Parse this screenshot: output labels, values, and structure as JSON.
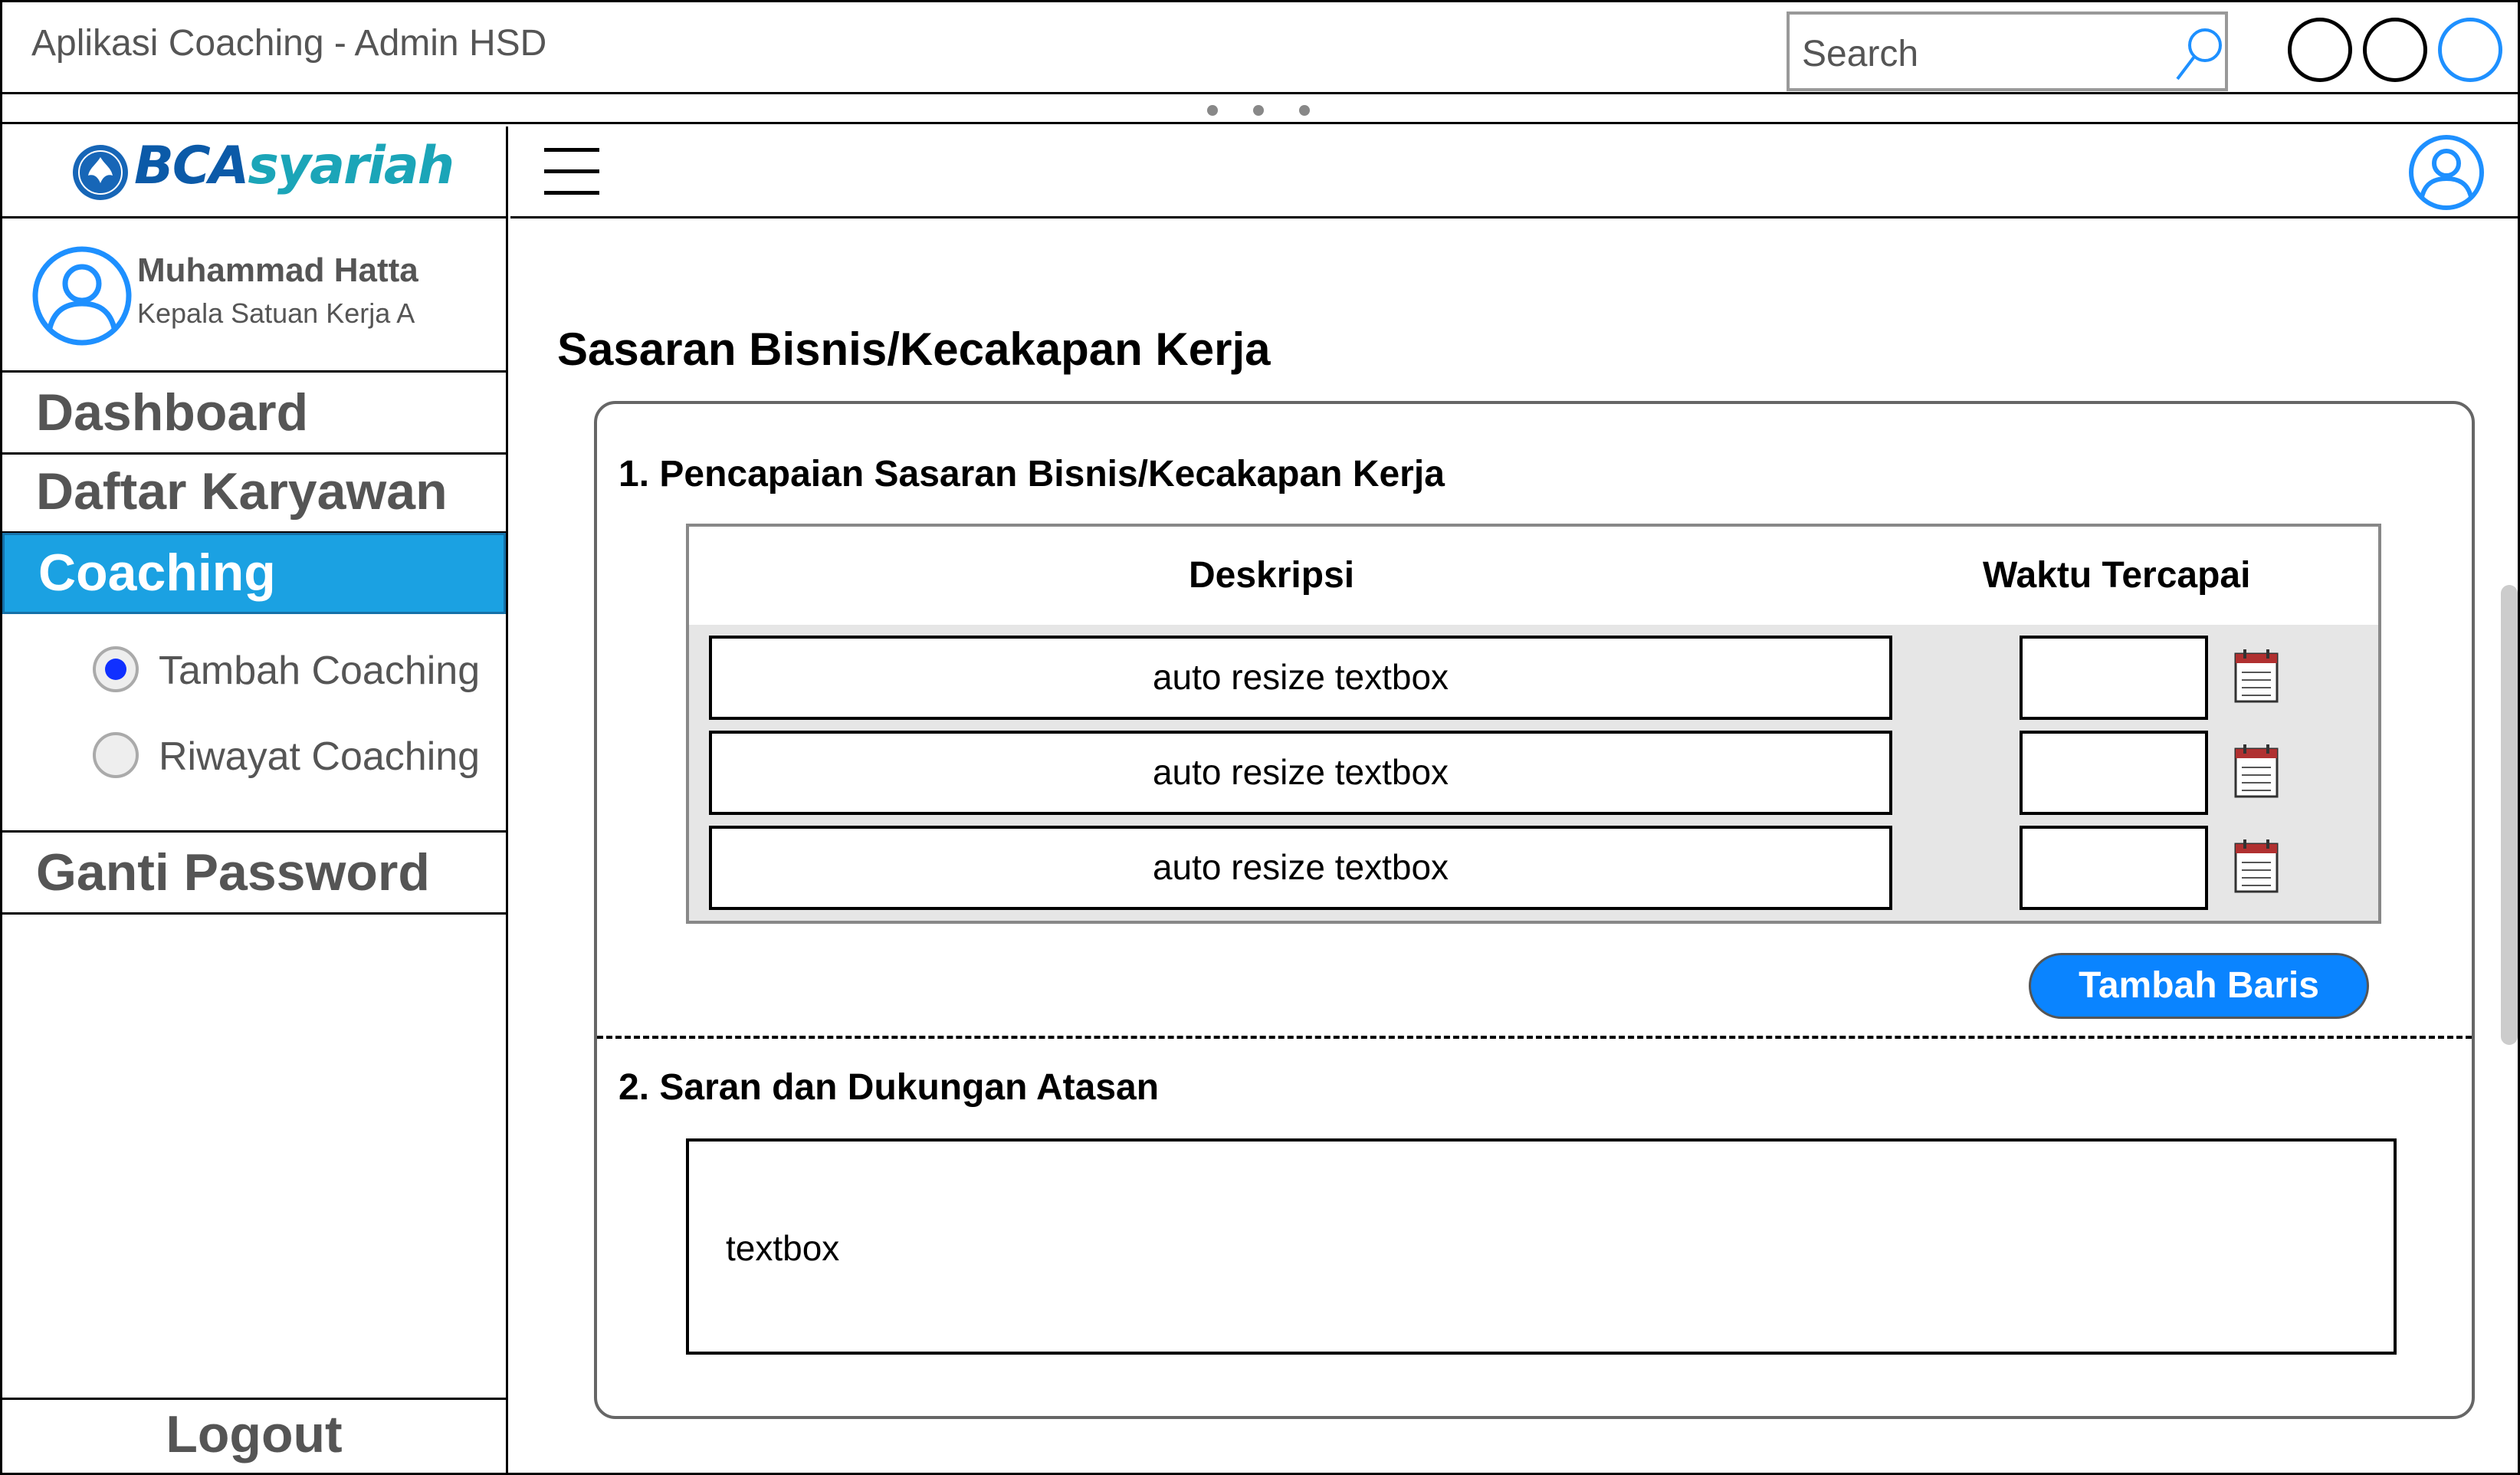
{
  "window": {
    "title": "Aplikasi Coaching - Admin HSD",
    "search_placeholder": "Search"
  },
  "sidebar": {
    "logo": {
      "part1": "BCA",
      "part2": "syariah"
    },
    "user": {
      "name": "Muhammad Hatta",
      "role": "Kepala Satuan Kerja A"
    },
    "menu": [
      {
        "label": "Dashboard"
      },
      {
        "label": "Daftar Karyawan"
      },
      {
        "label": "Coaching",
        "active": true
      },
      {
        "label": "Ganti Password"
      }
    ],
    "submenu": [
      {
        "label": "Tambah Coaching",
        "selected": true
      },
      {
        "label": "Riwayat Coaching",
        "selected": false
      }
    ],
    "logout": "Logout"
  },
  "main": {
    "page_title": "Sasaran Bisnis/Kecakapan Kerja",
    "section1": {
      "title": "1. Pencapaian Sasaran Bisnis/Kecakapan Kerja",
      "columns": [
        "Deskripsi",
        "Waktu Tercapai"
      ],
      "rows": [
        {
          "description": "auto resize textbox",
          "date": ""
        },
        {
          "description": "auto resize textbox",
          "date": ""
        },
        {
          "description": "auto resize textbox",
          "date": ""
        }
      ],
      "add_row_label": "Tambah Baris"
    },
    "section2": {
      "title": "2. Saran dan Dukungan Atasan",
      "textbox": "textbox"
    }
  },
  "colors": {
    "accent": "#1ba1e2",
    "button": "#0a84ff",
    "radio_selected": "#1030ff",
    "icon_blue": "#1e90ff"
  }
}
